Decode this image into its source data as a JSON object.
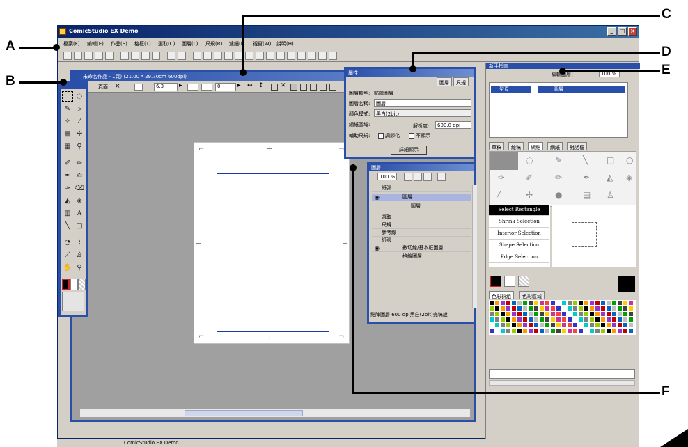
{
  "callouts": {
    "a": "A",
    "b": "B",
    "c": "C",
    "d": "D",
    "e": "E",
    "f": "F"
  },
  "app": {
    "title": "ComicStudio EX Demo",
    "status": "ComicStudio EX Demo",
    "minimize_glyph": "_",
    "maximize_glyph": "□",
    "close_glyph": "×",
    "accent": "#2a4fa8",
    "menu": [
      "檔案(F)",
      "編輯(E)",
      "作品(S)",
      "格框(T)",
      "選取(C)",
      "圖層(L)",
      "尺規(R)",
      "濾鏡(I)",
      "視窗(W)",
      "說明(H)"
    ]
  },
  "document": {
    "title": "未命名作品 - 1頁) (21.00 * 29.70cm 600dpi)",
    "page_tab": "頁面",
    "zoom": "6.3",
    "rotation": "0"
  },
  "properties": {
    "title": "屬性",
    "tabs": [
      "圖層",
      "尺規"
    ],
    "rows": [
      {
        "label": "圖層類型:",
        "value": "點陣圖層"
      },
      {
        "label": "圖層名稱:",
        "value": "圖層"
      },
      {
        "label": "顏色模式:",
        "value": "黑白(2bit)"
      }
    ],
    "output_label": "網紙區域:",
    "resolution_label": "解析度:",
    "resolution_value": "600.0 dpi",
    "ruler_label": "輔助尺規:",
    "check1": "調節化",
    "check2": "不顯示",
    "details_button": "詳細顯示"
  },
  "layers": {
    "title": "圖層",
    "opacity": "100 %",
    "group_label": "紙張",
    "items": [
      "圖層",
      "圖層",
      "選取",
      "尺規",
      "參考線",
      "紙張",
      "數切線/基本框圖層",
      "格線圖層"
    ],
    "status": "點陣圖層 600 dpi黑白(2bit)完稿設"
  },
  "right": {
    "title": "新手指南",
    "zoom_label": "編輯圖層：",
    "zoom_value": "100 %",
    "layer_name": "圖層",
    "type_label": "型頁",
    "tabs": [
      "草稿",
      "線稿",
      "網點",
      "網紙",
      "對話框"
    ],
    "selection_items": [
      "Select Rectangle",
      "Shrink Selection",
      "Interior Selection",
      "Shape Selection",
      "Edge Selection"
    ],
    "color_tabs": [
      "色彩群組",
      "色彩區域"
    ]
  }
}
